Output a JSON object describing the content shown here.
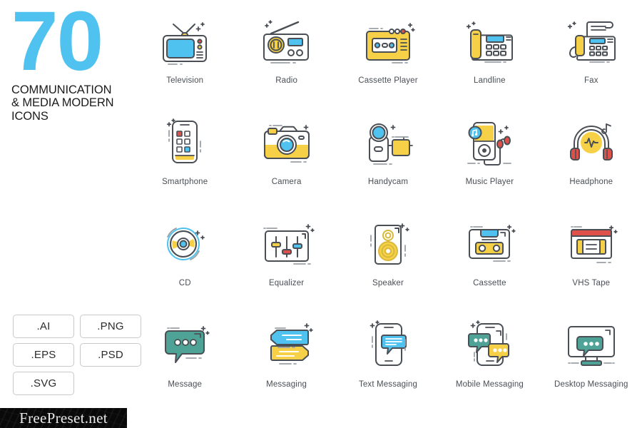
{
  "title": {
    "count": "70",
    "subtitle": "COMMUNICATION\n& MEDIA MODERN\nICONS",
    "accent_color": "#4FC2F0"
  },
  "formats": [
    {
      "label": ".AI"
    },
    {
      "label": ".PNG"
    },
    {
      "label": ".EPS"
    },
    {
      "label": ".PSD"
    },
    {
      "label": ".SVG"
    }
  ],
  "watermark": {
    "text": "FreePreset.net"
  },
  "palette": {
    "blue": "#4FC2F0",
    "yellow": "#F6D147",
    "red": "#E0504A",
    "teal": "#4FA396",
    "outline": "#4A4F55",
    "light_outline": "#9AA0A6"
  },
  "icons": [
    {
      "id": "television",
      "label": "Television",
      "icon_name": "television-icon"
    },
    {
      "id": "radio",
      "label": "Radio",
      "icon_name": "radio-icon"
    },
    {
      "id": "cassette-player",
      "label": "Cassette Player",
      "icon_name": "cassette-player-icon"
    },
    {
      "id": "landline",
      "label": "Landline",
      "icon_name": "landline-phone-icon"
    },
    {
      "id": "fax",
      "label": "Fax",
      "icon_name": "fax-machine-icon"
    },
    {
      "id": "smartphone",
      "label": "Smartphone",
      "icon_name": "smartphone-icon"
    },
    {
      "id": "camera",
      "label": "Camera",
      "icon_name": "camera-icon"
    },
    {
      "id": "handycam",
      "label": "Handycam",
      "icon_name": "handycam-icon"
    },
    {
      "id": "music-player",
      "label": "Music Player",
      "icon_name": "music-player-icon"
    },
    {
      "id": "headphone",
      "label": "Headphone",
      "icon_name": "headphone-icon"
    },
    {
      "id": "cd",
      "label": "CD",
      "icon_name": "cd-disc-icon"
    },
    {
      "id": "equalizer",
      "label": "Equalizer",
      "icon_name": "equalizer-icon"
    },
    {
      "id": "speaker",
      "label": "Speaker",
      "icon_name": "speaker-icon"
    },
    {
      "id": "cassette",
      "label": "Cassette",
      "icon_name": "cassette-tape-icon"
    },
    {
      "id": "vhs-tape",
      "label": "VHS Tape",
      "icon_name": "vhs-tape-icon"
    },
    {
      "id": "message",
      "label": "Message",
      "icon_name": "message-bubble-icon"
    },
    {
      "id": "messaging",
      "label": "Messaging",
      "icon_name": "messaging-bubbles-icon"
    },
    {
      "id": "text-messaging",
      "label": "Text Messaging",
      "icon_name": "text-messaging-icon"
    },
    {
      "id": "mobile-messaging",
      "label": "Mobile Messaging",
      "icon_name": "mobile-messaging-icon"
    },
    {
      "id": "desktop-messaging",
      "label": "Desktop Messaging",
      "icon_name": "desktop-messaging-icon"
    }
  ]
}
